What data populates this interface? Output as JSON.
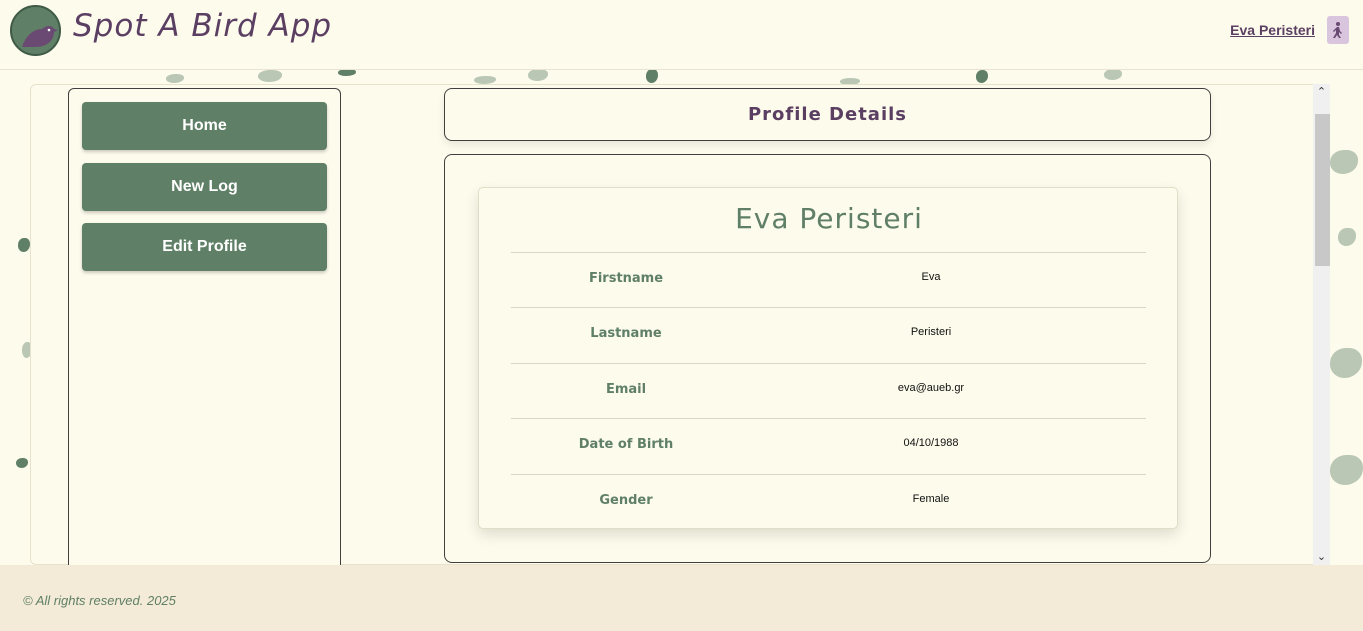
{
  "header": {
    "app_title": "Spot A Bird App",
    "logo_text": "Spot A Bird",
    "user_name": "Eva Peristeri"
  },
  "sidebar": {
    "buttons": [
      {
        "label": "Home"
      },
      {
        "label": "New Log"
      },
      {
        "label": "Edit Profile"
      }
    ]
  },
  "main": {
    "section_title": "Profile Details",
    "profile": {
      "full_name": "Eva Peristeri",
      "fields": [
        {
          "label": "Firstname",
          "value": "Eva"
        },
        {
          "label": "Lastname",
          "value": "Peristeri"
        },
        {
          "label": "Email",
          "value": "eva@aueb.gr"
        },
        {
          "label": "Date of Birth",
          "value": "04/10/1988"
        },
        {
          "label": "Gender",
          "value": "Female"
        }
      ]
    }
  },
  "footer": {
    "text": "© All rights reserved. 2025"
  },
  "colors": {
    "accent_green": "#5f7f66",
    "accent_purple": "#5b3f63",
    "background": "#fdfbeb",
    "footer_bg": "#f3ebd7"
  },
  "icons": {
    "user_icon": "walking-person-icon",
    "logo_icon": "bird-icon"
  }
}
